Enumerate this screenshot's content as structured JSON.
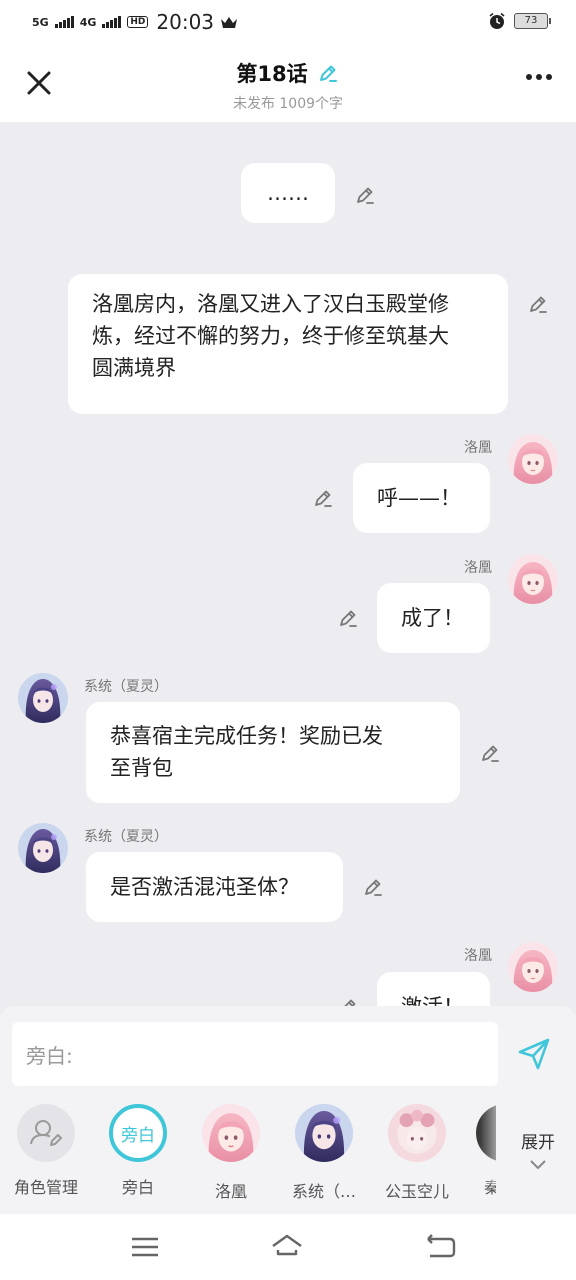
{
  "status": {
    "net1": "5G",
    "net2": "4G",
    "hd": "HD",
    "time": "20:03",
    "battery": "73"
  },
  "header": {
    "title": "第18话",
    "subtitle": "未发布 1009个字"
  },
  "messages": [
    {
      "type": "narration",
      "text": "……"
    },
    {
      "type": "narration",
      "lines": [
        "洛凰房内，洛凰又进入了汉白玉殿堂修",
        "炼，经过不懈的努力，终于修至筑基大",
        "圆满境界"
      ]
    },
    {
      "type": "right",
      "speaker": "洛凰",
      "text": "呼——！"
    },
    {
      "type": "right",
      "speaker": "洛凰",
      "text": "成了！"
    },
    {
      "type": "left",
      "speaker": "系统（夏灵）",
      "lines": [
        "恭喜宿主完成任务！奖励已发",
        "至背包"
      ]
    },
    {
      "type": "left",
      "speaker": "系统（夏灵）",
      "text": "是否激活混沌圣体？"
    },
    {
      "type": "right",
      "speaker": "洛凰",
      "text": "激活！"
    }
  ],
  "input": {
    "placeholder": "旁白:"
  },
  "roles": [
    {
      "label": "角色管理",
      "icon": "person-edit-icon"
    },
    {
      "label": "旁白",
      "badge": "旁白"
    },
    {
      "label": "洛凰"
    },
    {
      "label": "系统（…"
    },
    {
      "label": "公玉空儿"
    },
    {
      "label": "秦"
    }
  ],
  "expand_label": "展开",
  "colors": {
    "accent": "#3fc6d8",
    "chat_bg": "#ececf1"
  }
}
